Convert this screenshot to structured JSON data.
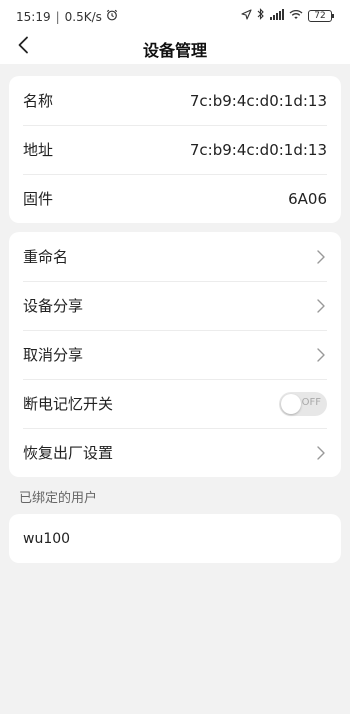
{
  "status_bar": {
    "time": "15:19",
    "separator": "|",
    "speed": "0.5K/s",
    "battery": "72"
  },
  "header": {
    "title": "设备管理"
  },
  "device_info": [
    {
      "label": "名称",
      "value": "7c:b9:4c:d0:1d:13"
    },
    {
      "label": "地址",
      "value": "7c:b9:4c:d0:1d:13"
    },
    {
      "label": "固件",
      "value": "6A06"
    }
  ],
  "actions": {
    "rename": "重命名",
    "share": "设备分享",
    "unshare": "取消分享",
    "power_memory": "断电记忆开关",
    "power_memory_state": "OFF",
    "factory_reset": "恢复出厂设置"
  },
  "bound_users": {
    "section_label": "已绑定的用户",
    "users": [
      "wu100"
    ]
  },
  "icons": {
    "back": "back-arrow-icon",
    "chevron": "chevron-right-icon",
    "alarm": "alarm-icon",
    "location": "location-icon",
    "bluetooth": "bluetooth-icon",
    "signal": "signal-icon",
    "wifi": "wifi-icon"
  },
  "colors": {
    "background": "#f2f2f2",
    "card": "#ffffff",
    "toggle_off": "#e7e7e7"
  }
}
